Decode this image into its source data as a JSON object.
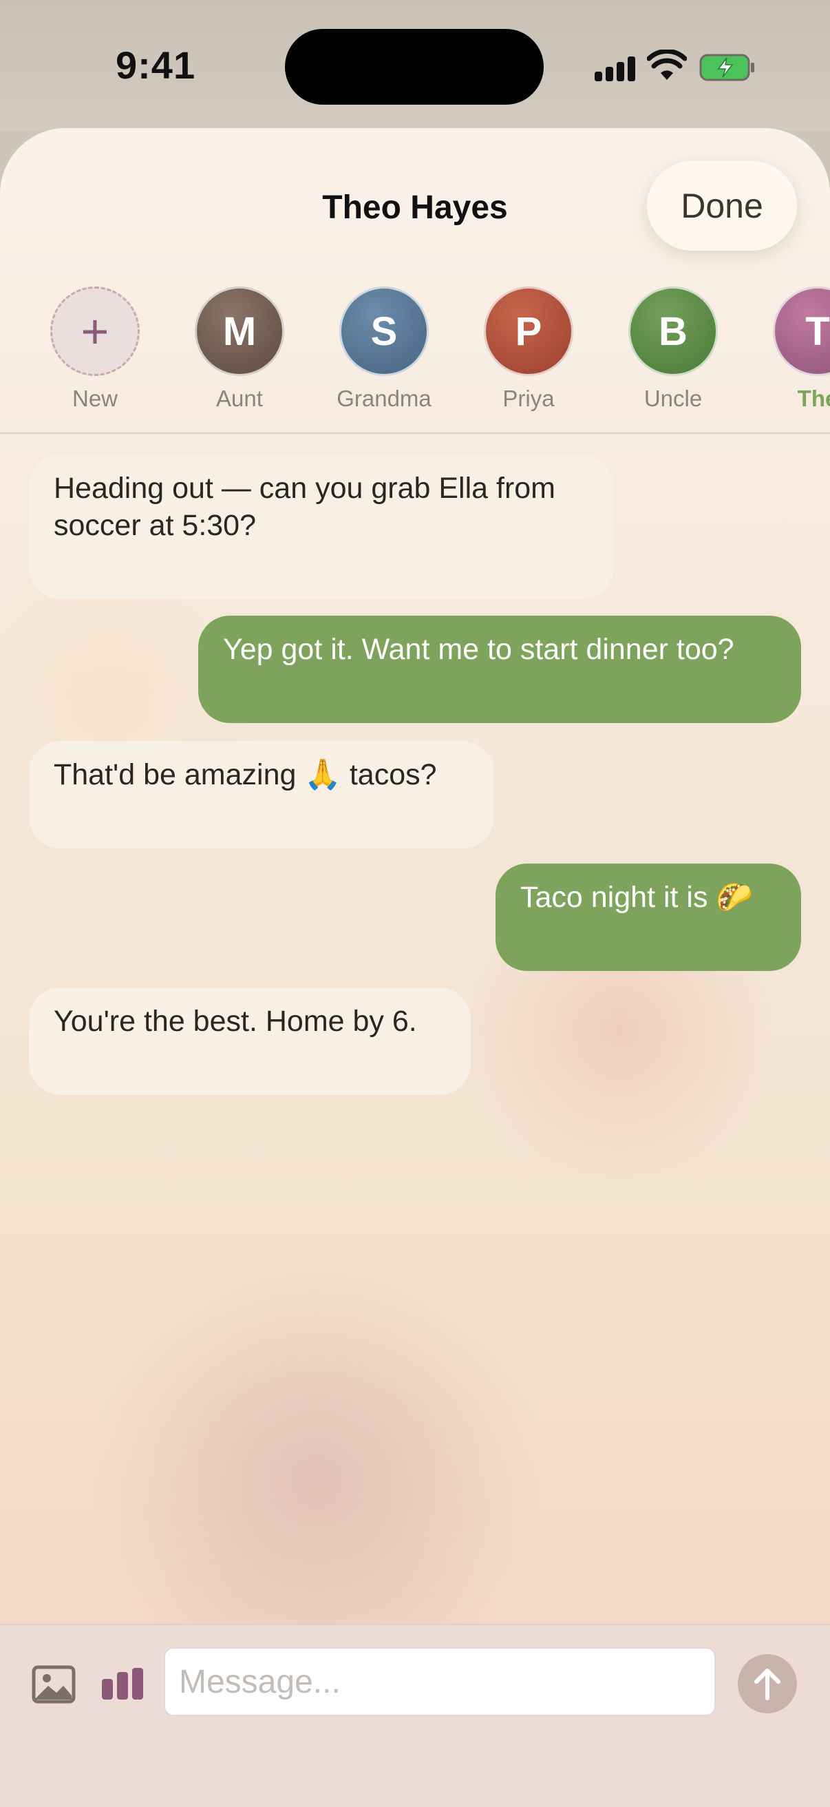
{
  "status_bar": {
    "time": "9:41"
  },
  "header": {
    "title": "Theo Hayes",
    "done_label": "Done"
  },
  "contacts": [
    {
      "initial": "+",
      "label": "New",
      "color": "#eadfdc"
    },
    {
      "initial": "M",
      "label": "Aunt",
      "color": "#6f5a4f"
    },
    {
      "initial": "S",
      "label": "Grandma",
      "color": "#557493"
    },
    {
      "initial": "P",
      "label": "Priya",
      "color": "#b0503a"
    },
    {
      "initial": "B",
      "label": "Uncle",
      "color": "#5a8a45"
    },
    {
      "initial": "T",
      "label": "The",
      "color": "#a8688a",
      "active": true
    }
  ],
  "messages": [
    {
      "dir": "in",
      "text": "Heading out — can you grab Ella from soccer at 5:30?"
    },
    {
      "dir": "out",
      "text": "Yep got it. Want me to start dinner too?"
    },
    {
      "dir": "in",
      "text": "That'd be amazing 🙏 tacos?"
    },
    {
      "dir": "out",
      "text": "Taco night it is 🌮"
    },
    {
      "dir": "in",
      "text": "You're the best. Home by 6."
    }
  ],
  "composer": {
    "placeholder": "Message..."
  },
  "colors": {
    "accent_green": "#7ea35c",
    "accent_purple": "#8c5a78"
  }
}
